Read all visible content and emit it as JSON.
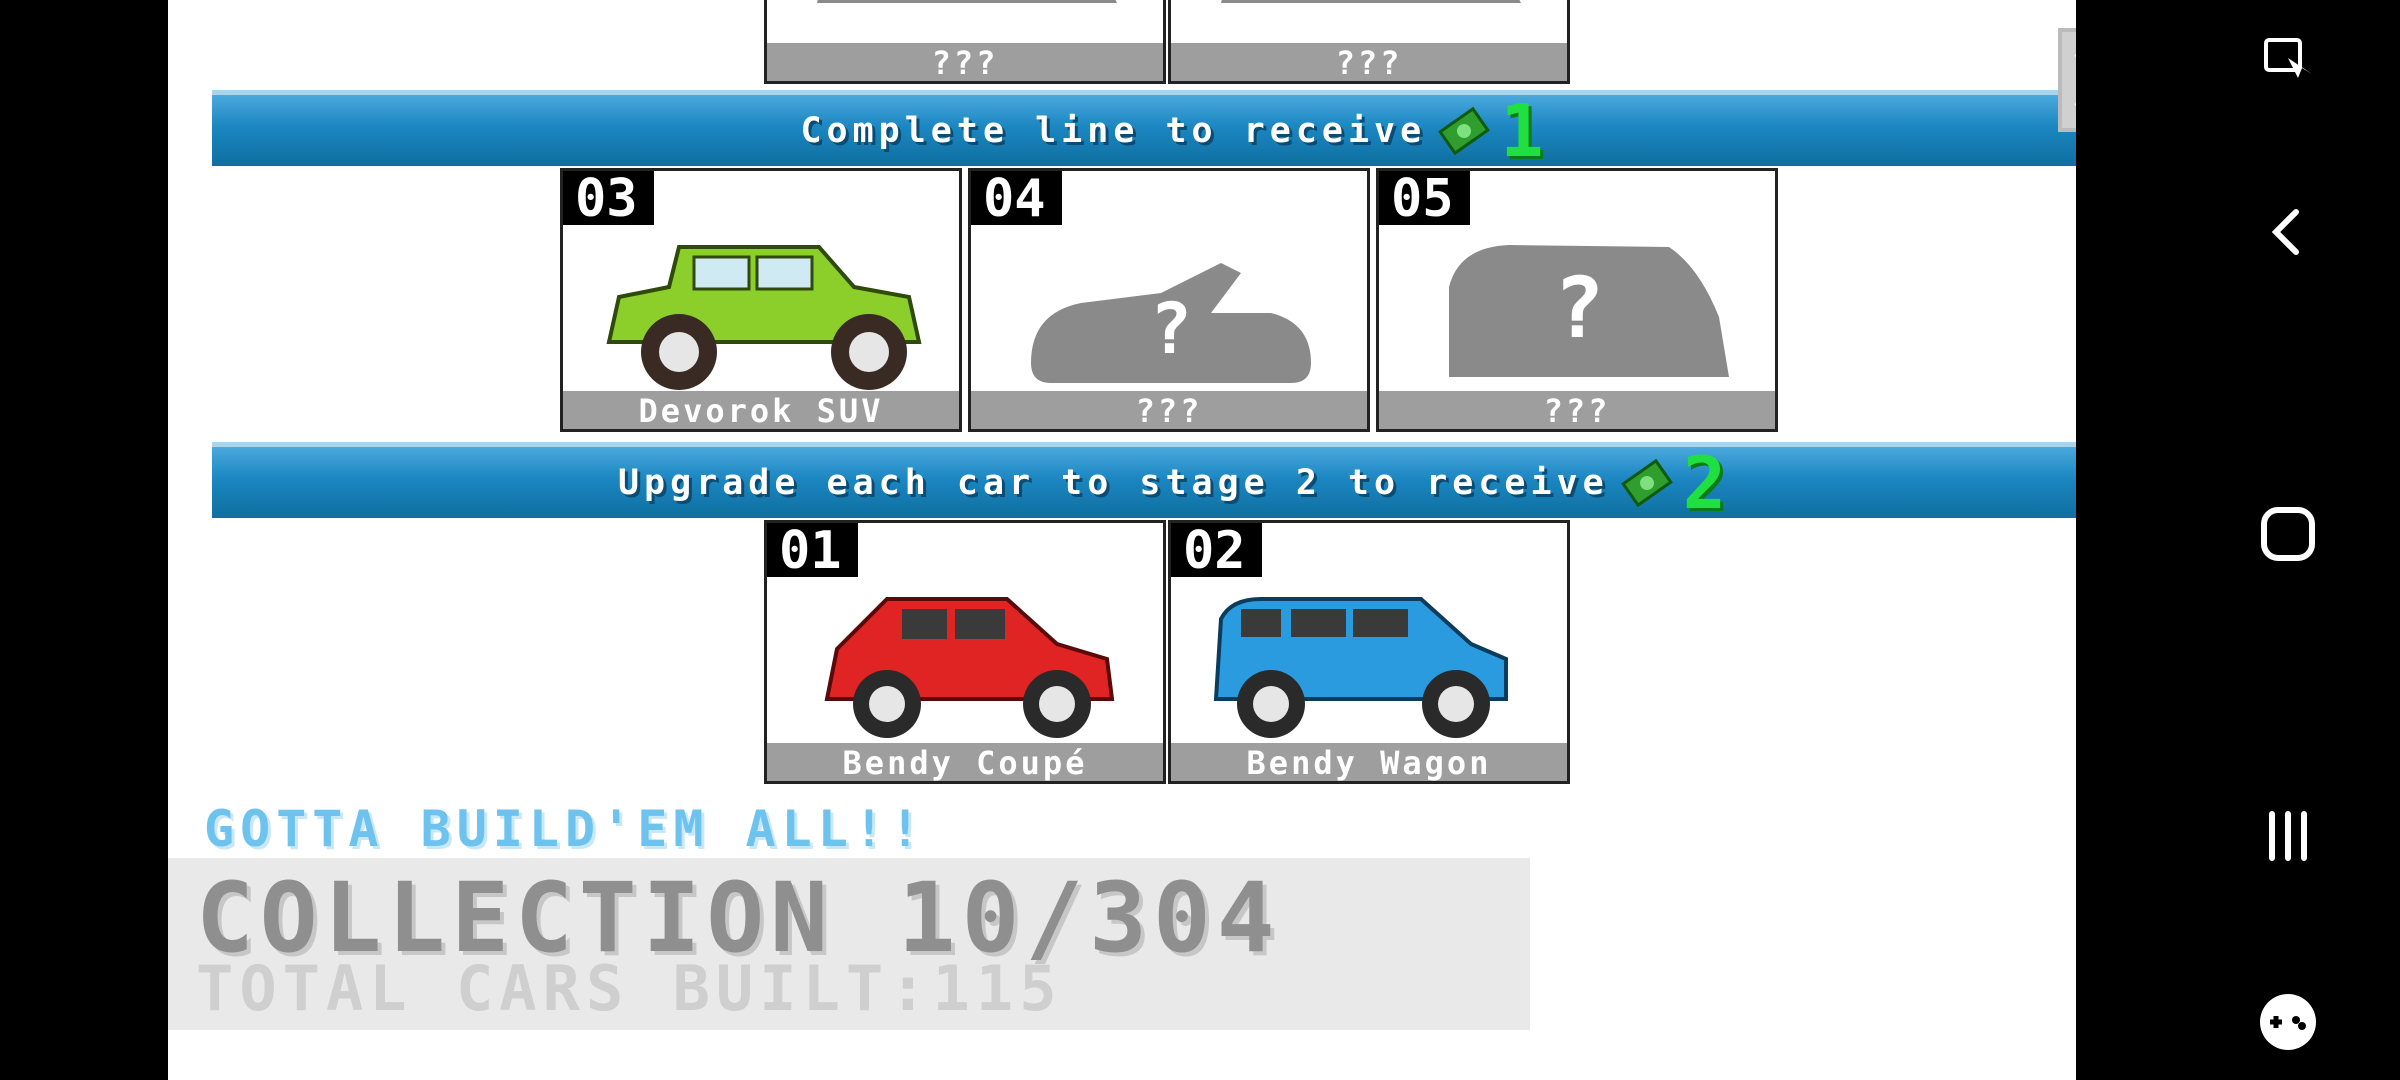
{
  "top_row": {
    "labels": [
      "???",
      "???"
    ]
  },
  "banner_line": {
    "text": "Complete line to receive",
    "reward": "1"
  },
  "row_middle": [
    {
      "number": "03",
      "name": "Devorok SUV"
    },
    {
      "number": "04",
      "name": "???"
    },
    {
      "number": "05",
      "name": "???"
    }
  ],
  "banner_upgrade": {
    "text": "Upgrade each car to stage 2 to receive",
    "reward": "2"
  },
  "row_bottom": [
    {
      "number": "01",
      "name": "Bendy Coupé"
    },
    {
      "number": "02",
      "name": "Bendy Wagon"
    }
  ],
  "footer": {
    "tagline": "GOTTA BUILD'EM ALL!!",
    "collection": "COLLECTION 10/304",
    "total": "TOTAL CARS BUILT:115"
  },
  "colors": {
    "banner": "#1b86c1",
    "reward_green": "#1fe040",
    "suv": "#8ccf2a",
    "coupe": "#e02424",
    "wagon": "#2b9be0"
  },
  "icons": [
    "close-icon",
    "money-icon",
    "back-icon",
    "home-icon",
    "recents-icon",
    "gamepad-icon",
    "screen-touch-icon"
  ]
}
